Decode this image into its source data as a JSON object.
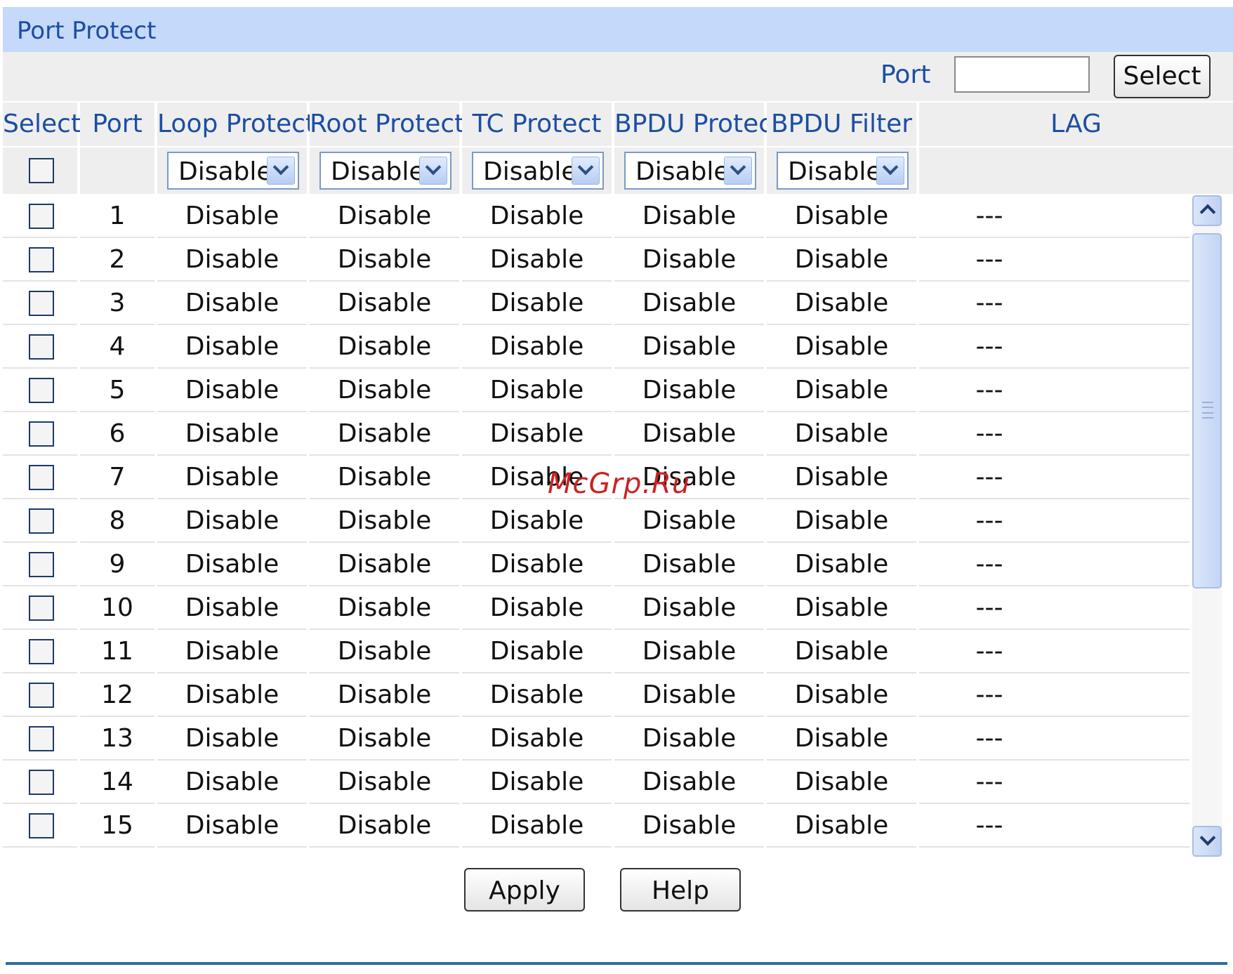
{
  "title": "Port Protect",
  "port_filter": {
    "label": "Port",
    "value": "",
    "button": "Select"
  },
  "columns": [
    "Select",
    "Port",
    "Loop Protect",
    "Root Protect",
    "TC Protect",
    "BPDU Protect",
    "BPDU Filter",
    "LAG"
  ],
  "bulk": {
    "loop": "Disable",
    "root": "Disable",
    "tc": "Disable",
    "bpdu": "Disable",
    "filter": "Disable"
  },
  "rows": [
    {
      "port": "1",
      "loop": "Disable",
      "root": "Disable",
      "tc": "Disable",
      "bpdu": "Disable",
      "filter": "Disable",
      "lag": "---"
    },
    {
      "port": "2",
      "loop": "Disable",
      "root": "Disable",
      "tc": "Disable",
      "bpdu": "Disable",
      "filter": "Disable",
      "lag": "---"
    },
    {
      "port": "3",
      "loop": "Disable",
      "root": "Disable",
      "tc": "Disable",
      "bpdu": "Disable",
      "filter": "Disable",
      "lag": "---"
    },
    {
      "port": "4",
      "loop": "Disable",
      "root": "Disable",
      "tc": "Disable",
      "bpdu": "Disable",
      "filter": "Disable",
      "lag": "---"
    },
    {
      "port": "5",
      "loop": "Disable",
      "root": "Disable",
      "tc": "Disable",
      "bpdu": "Disable",
      "filter": "Disable",
      "lag": "---"
    },
    {
      "port": "6",
      "loop": "Disable",
      "root": "Disable",
      "tc": "Disable",
      "bpdu": "Disable",
      "filter": "Disable",
      "lag": "---"
    },
    {
      "port": "7",
      "loop": "Disable",
      "root": "Disable",
      "tc": "Disable",
      "bpdu": "Disable",
      "filter": "Disable",
      "lag": "---"
    },
    {
      "port": "8",
      "loop": "Disable",
      "root": "Disable",
      "tc": "Disable",
      "bpdu": "Disable",
      "filter": "Disable",
      "lag": "---"
    },
    {
      "port": "9",
      "loop": "Disable",
      "root": "Disable",
      "tc": "Disable",
      "bpdu": "Disable",
      "filter": "Disable",
      "lag": "---"
    },
    {
      "port": "10",
      "loop": "Disable",
      "root": "Disable",
      "tc": "Disable",
      "bpdu": "Disable",
      "filter": "Disable",
      "lag": "---"
    },
    {
      "port": "11",
      "loop": "Disable",
      "root": "Disable",
      "tc": "Disable",
      "bpdu": "Disable",
      "filter": "Disable",
      "lag": "---"
    },
    {
      "port": "12",
      "loop": "Disable",
      "root": "Disable",
      "tc": "Disable",
      "bpdu": "Disable",
      "filter": "Disable",
      "lag": "---"
    },
    {
      "port": "13",
      "loop": "Disable",
      "root": "Disable",
      "tc": "Disable",
      "bpdu": "Disable",
      "filter": "Disable",
      "lag": "---"
    },
    {
      "port": "14",
      "loop": "Disable",
      "root": "Disable",
      "tc": "Disable",
      "bpdu": "Disable",
      "filter": "Disable",
      "lag": "---"
    },
    {
      "port": "15",
      "loop": "Disable",
      "root": "Disable",
      "tc": "Disable",
      "bpdu": "Disable",
      "filter": "Disable",
      "lag": "---"
    }
  ],
  "actions": {
    "apply": "Apply",
    "help": "Help"
  },
  "watermark": "McGrp.Ru",
  "colors": {
    "header_bg": "#c5d9fb",
    "label_text": "#1c4ea3",
    "panel_bg": "#eeeeee",
    "divider": "#2c6f9f"
  }
}
